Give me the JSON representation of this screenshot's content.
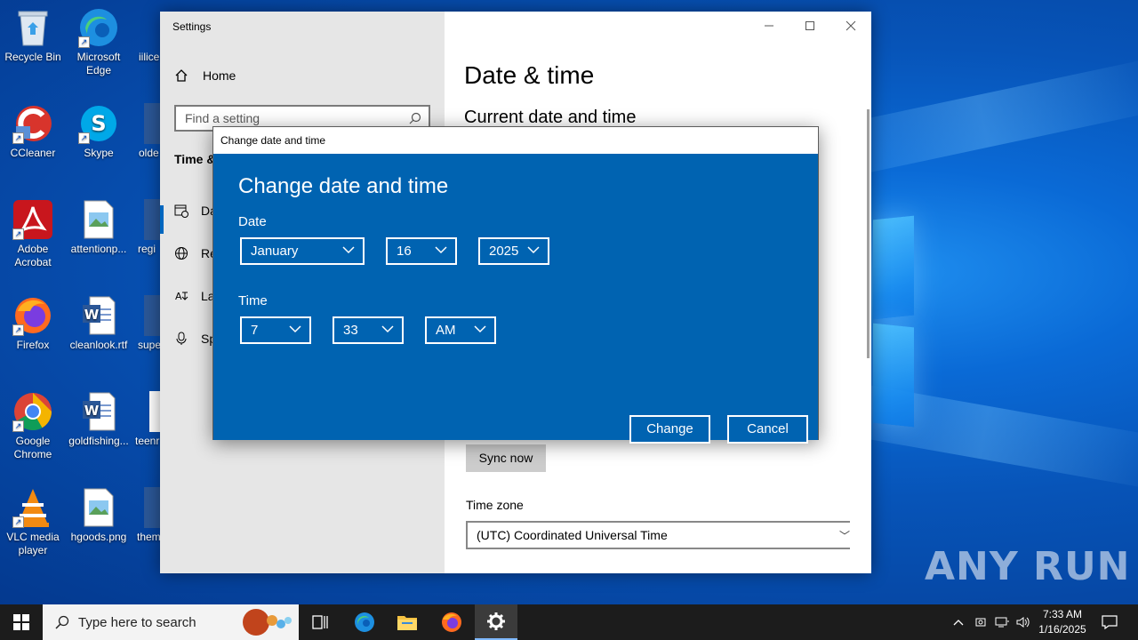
{
  "desktop": {
    "icons": [
      {
        "label": "Recycle Bin",
        "icon": "recycle-bin-icon"
      },
      {
        "label": "Microsoft Edge",
        "icon": "edge-icon"
      },
      {
        "label": "iilice",
        "icon": "word-doc-icon"
      },
      {
        "label": "CCleaner",
        "icon": "ccleaner-icon"
      },
      {
        "label": "Skype",
        "icon": "skype-icon"
      },
      {
        "label": "olde",
        "icon": "word-doc-icon"
      },
      {
        "label": "Adobe Acrobat",
        "icon": "acrobat-icon"
      },
      {
        "label": "attentionp...",
        "icon": "image-file-icon"
      },
      {
        "label": "regi",
        "icon": "word-doc-icon"
      },
      {
        "label": "Firefox",
        "icon": "firefox-icon"
      },
      {
        "label": "cleanlook.rtf",
        "icon": "word-doc-icon"
      },
      {
        "label": "supe",
        "icon": "word-doc-icon"
      },
      {
        "label": "Google Chrome",
        "icon": "chrome-icon"
      },
      {
        "label": "goldfishing...",
        "icon": "word-doc-icon"
      },
      {
        "label": "teenr",
        "icon": "word-doc-icon"
      },
      {
        "label": "VLC media player",
        "icon": "vlc-icon"
      },
      {
        "label": "hgoods.png",
        "icon": "image-file-icon"
      },
      {
        "label": "them",
        "icon": "word-doc-icon"
      }
    ],
    "watermark": "ANY RUN"
  },
  "settings": {
    "title": "Settings",
    "home_label": "Home",
    "search_placeholder": "Find a setting",
    "section_label": "Time &",
    "nav_items": [
      {
        "label": "Da",
        "icon": "calendar-clock-icon"
      },
      {
        "label": "Re",
        "icon": "globe-icon"
      },
      {
        "label": "La",
        "icon": "language-icon"
      },
      {
        "label": "Sp",
        "icon": "microphone-icon"
      }
    ],
    "page_title": "Date & time",
    "section_title": "Current date and time",
    "sync_button": "Sync now",
    "timezone_label": "Time zone",
    "timezone_value": "(UTC) Coordinated Universal Time"
  },
  "dialog": {
    "window_title": "Change date and time",
    "heading": "Change date and time",
    "date_label": "Date",
    "month": "January",
    "day": "16",
    "year": "2025",
    "time_label": "Time",
    "hour": "7",
    "minute": "33",
    "ampm": "AM",
    "change_button": "Change",
    "cancel_button": "Cancel",
    "accent_color": "#0063b1"
  },
  "taskbar": {
    "search_placeholder": "Type here to search",
    "time": "7:33 AM",
    "date": "1/16/2025"
  }
}
